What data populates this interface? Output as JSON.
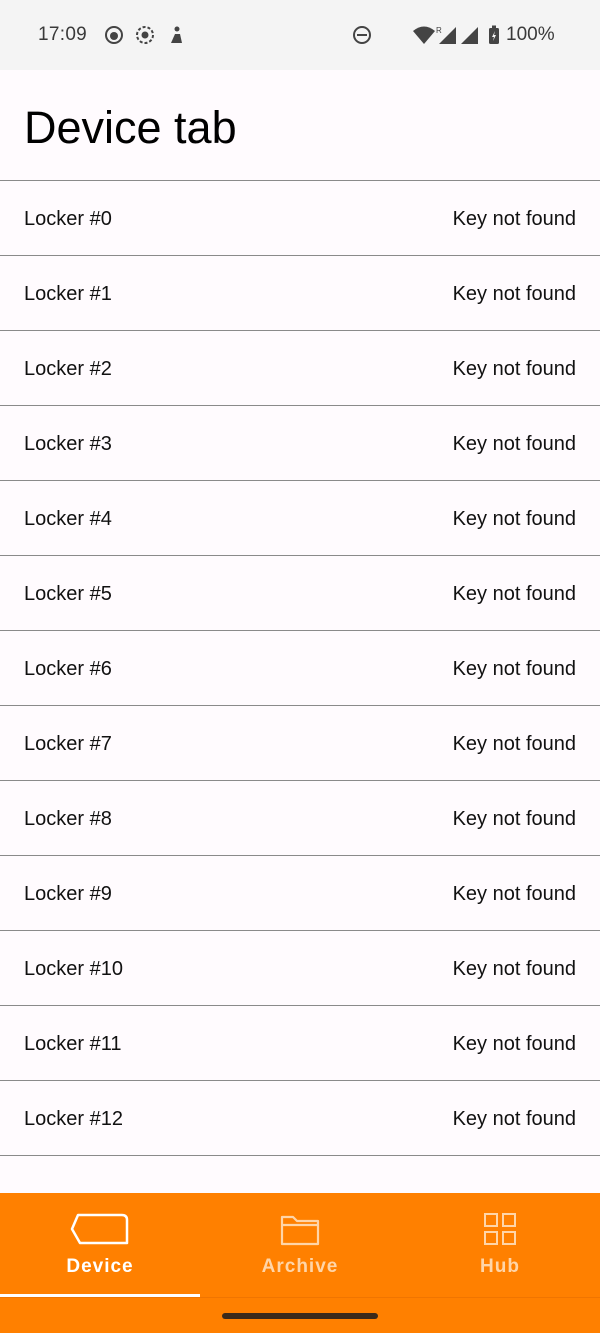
{
  "status_bar": {
    "time": "17:09",
    "battery": "100%",
    "icons": [
      "github-icon",
      "screen-record-icon",
      "accessibility-icon",
      "do-not-disturb-icon",
      "wifi-icon",
      "signal-icon",
      "signal-icon",
      "battery-icon"
    ]
  },
  "header": {
    "title": "Device tab"
  },
  "lockers": [
    {
      "label": "Locker #0",
      "status": "Key not found"
    },
    {
      "label": "Locker #1",
      "status": "Key not found"
    },
    {
      "label": "Locker #2",
      "status": "Key not found"
    },
    {
      "label": "Locker #3",
      "status": "Key not found"
    },
    {
      "label": "Locker #4",
      "status": "Key not found"
    },
    {
      "label": "Locker #5",
      "status": "Key not found"
    },
    {
      "label": "Locker #6",
      "status": "Key not found"
    },
    {
      "label": "Locker #7",
      "status": "Key not found"
    },
    {
      "label": "Locker #8",
      "status": "Key not found"
    },
    {
      "label": "Locker #9",
      "status": "Key not found"
    },
    {
      "label": "Locker #10",
      "status": "Key not found"
    },
    {
      "label": "Locker #11",
      "status": "Key not found"
    },
    {
      "label": "Locker #12",
      "status": "Key not found"
    }
  ],
  "nav": {
    "items": [
      {
        "label": "Device",
        "icon": "device-icon",
        "active": true
      },
      {
        "label": "Archive",
        "icon": "folder-icon",
        "active": false
      },
      {
        "label": "Hub",
        "icon": "grid-icon",
        "active": false
      }
    ]
  },
  "colors": {
    "accent": "#ff8000",
    "background": "#fffbfe",
    "divider": "#8a8a8a"
  }
}
